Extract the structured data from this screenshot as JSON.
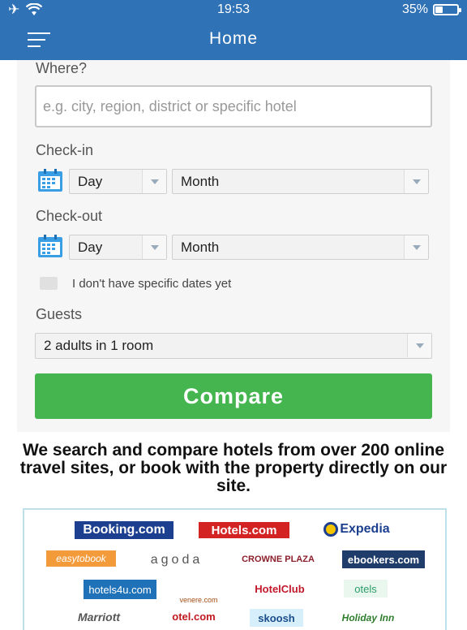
{
  "status": {
    "time": "19:53",
    "battery": "35%"
  },
  "nav": {
    "title": "Home"
  },
  "form": {
    "where_label": "Where?",
    "where_placeholder": "e.g. city, region, district or specific hotel",
    "checkin_label": "Check-in",
    "checkout_label": "Check-out",
    "day_value": "Day",
    "month_value": "Month",
    "no_dates_label": "I don't have specific dates yet",
    "guests_label": "Guests",
    "guests_value": "2 adults in 1 room",
    "compare_label": "Compare"
  },
  "tagline": "We search and compare hotels from over 200 online travel sites, or book with the property directly on our site.",
  "partners": [
    "Booking.com",
    "Hotels.com",
    "Expedia",
    "easytobook",
    "agoda",
    "CROWNE PLAZA",
    "ebookers.com",
    "hotels4u.com",
    "venere.com",
    "HotelClub",
    "otels",
    "Marriott",
    "otel.com",
    "skoosh",
    "Holiday Inn"
  ],
  "colors": {
    "nav_blue": "#2f72b6",
    "compare_green": "#45b64f"
  }
}
